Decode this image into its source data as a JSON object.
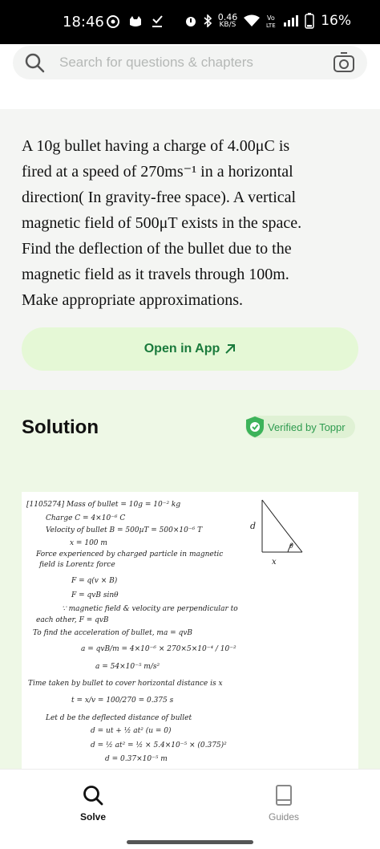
{
  "status_bar": {
    "time": "18:46",
    "net_speed_value": "0.46",
    "net_speed_unit": "KB/S",
    "battery": "16%",
    "icons": [
      "sync-icon",
      "cat-icon",
      "download-check-icon",
      "alarm-icon",
      "bluetooth-icon",
      "wifi-icon",
      "volte-icon",
      "signal-icon",
      "battery-icon"
    ]
  },
  "search": {
    "placeholder": "Search for questions & chapters",
    "icons": [
      "search-icon",
      "camera-icon"
    ]
  },
  "question": {
    "lines": [
      "A 10g bullet having a charge of 4.00μC is",
      "fired at a speed of 270ms⁻¹ in a horizontal",
      "direction( In gravity-free space). A vertical",
      "magnetic field of 500μT  exists in the space.",
      "Find the deflection of the bullet due to the",
      "magnetic field as it travels through 100m.",
      "Make appropriate approximations."
    ]
  },
  "open_app": {
    "label": "Open in App",
    "icon": "arrow-up-right-icon"
  },
  "solution": {
    "title": "Solution",
    "verified_label": "Verified by Toppr",
    "handwritten_lines": [
      "[1105274] Mass of bullet = 10g = 10⁻² kg",
      "Charge  C = 4×10⁻⁶ C",
      "Velocity of bullet  B = 500µT = 500×10⁻⁶ T",
      "x = 100 m",
      "Force experienced by charged particle in magnetic",
      "field is  Lorentz force",
      "F = q(v × B)",
      "F = qvB sinθ",
      "∵ magnetic field & velocity are perpendicular to",
      "each other,   F = qvB",
      "To find the    acceleration of bullet,      ma = qvB",
      "a = qvB/m = 4×10⁻⁶ × 270×5×10⁻⁴ / 10⁻²",
      "a = 54×10⁻⁵ m/s²",
      "Time taken by bullet to cover horizontal distance is x",
      "t = x/v = 100/270 = 0.375 s",
      "Let d be the deflected distance of bullet",
      "d = ut + ½ at²   (u = 0)",
      "d = ½ at² = ½ × 5.4×10⁻⁵ × (0.375)²",
      "d = 0.37×10⁻⁵ m"
    ],
    "figure_labels": {
      "side": "d",
      "angle": "θ",
      "base": "x"
    }
  },
  "bottom_nav": {
    "items": [
      {
        "label": "Solve",
        "icon": "search-icon"
      },
      {
        "label": "Guides",
        "icon": "book-icon"
      }
    ]
  }
}
